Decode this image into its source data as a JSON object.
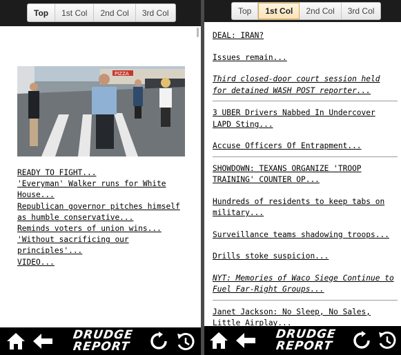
{
  "tabs": [
    "Top",
    "1st Col",
    "2nd Col",
    "3rd Col"
  ],
  "left": {
    "active_tab": "Top",
    "headlines": [
      "READY TO FIGHT...",
      "'Everyman' Walker runs for White House...",
      "Republican governor pitches himself as humble conservative...",
      "Reminds voters of union wins...",
      "'Without sacrificing our principles'...",
      "VIDEO..."
    ],
    "photo_sign": "PIZZA"
  },
  "right": {
    "active_tab": "1st Col",
    "items": [
      {
        "text": "DEAL: IRAN?",
        "italic": false,
        "ruled": false
      },
      {
        "text": "Issues remain...",
        "italic": false,
        "ruled": false
      },
      {
        "text": "Third closed-door court session held for detained WASH POST reporter...",
        "italic": true,
        "ruled": true
      },
      {
        "text": "3 UBER Drivers Nabbed In Undercover LAPD Sting...",
        "italic": false,
        "ruled": false
      },
      {
        "text": "Accuse Officers Of Entrapment...",
        "italic": false,
        "ruled": true
      },
      {
        "text": "SHOWDOWN: TEXANS ORGANIZE 'TROOP TRAINING' COUNTER OP...",
        "italic": false,
        "ruled": false
      },
      {
        "text": "Hundreds of residents to keep tabs on military...",
        "italic": false,
        "ruled": false
      },
      {
        "text": "Surveillance teams shadowing troops...",
        "italic": false,
        "ruled": false
      },
      {
        "text": "Drills stoke suspicion...",
        "italic": false,
        "ruled": false
      },
      {
        "text": "NYT: Memories of Waco Siege Continue to Fuel Far-Right Groups...",
        "italic": true,
        "ruled": true
      },
      {
        "text": "Janet Jackson: No Sleep, No Sales, Little Airplay...",
        "italic": false,
        "ruled": false
      }
    ]
  },
  "bottombar": {
    "logo_line1": "DRUDGE",
    "logo_line2": "REPORT",
    "icons": [
      "home-icon",
      "back-arrow-icon",
      "refresh-icon",
      "reload-history-icon"
    ]
  },
  "colors": {
    "bar": "#000000",
    "topbar": "#1c1c1c",
    "active_tab_border": "#e0a64a"
  }
}
